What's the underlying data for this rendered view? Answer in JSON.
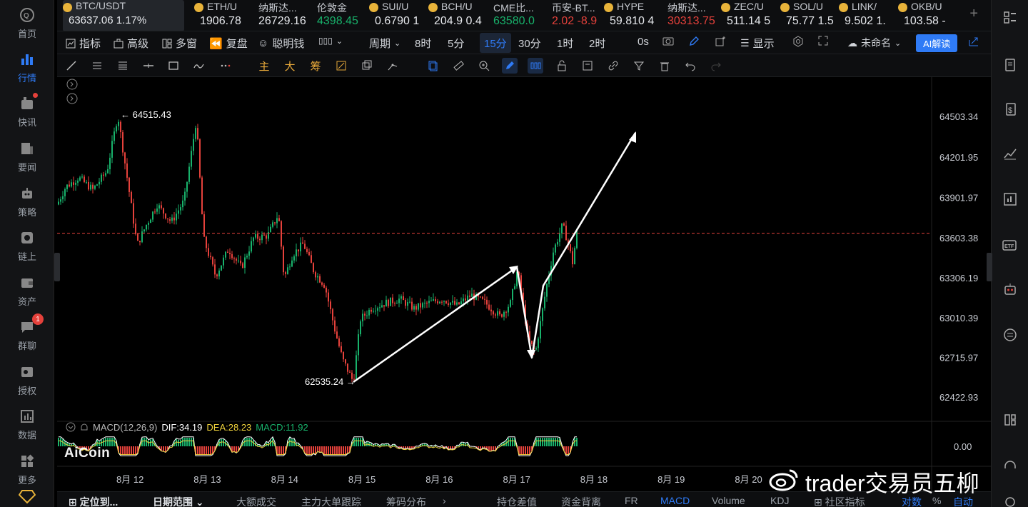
{
  "sidebar": {
    "items": [
      {
        "label": "首页",
        "icon": "home-icon"
      },
      {
        "label": "行情",
        "icon": "market-chart-icon",
        "active": true
      },
      {
        "label": "快讯",
        "icon": "flash-news-icon",
        "dot": true
      },
      {
        "label": "要闻",
        "icon": "news-icon"
      },
      {
        "label": "策略",
        "icon": "robot-strategy-icon"
      },
      {
        "label": "链上",
        "icon": "chain-icon"
      },
      {
        "label": "资产",
        "icon": "wallet-icon"
      },
      {
        "label": "群聊",
        "icon": "chat-icon",
        "badge": "1"
      },
      {
        "label": "授权",
        "icon": "key-icon"
      },
      {
        "label": "数据",
        "icon": "data-icon"
      },
      {
        "label": "更多",
        "icon": "more-grid-icon"
      }
    ]
  },
  "tickers": [
    {
      "name": "BTC/USDT",
      "price": "63637.06  1.17%",
      "color": "white",
      "icon": true
    },
    {
      "name": "ETH/U",
      "price": "1906.78",
      "color": "white",
      "icon": true
    },
    {
      "name": "纳斯达...",
      "price": "26729.16",
      "color": "white",
      "icon": false
    },
    {
      "name": "伦敦金",
      "price": "4398.45",
      "color": "green",
      "icon": false
    },
    {
      "name": "SUI/U",
      "price": "0.6790  1",
      "color": "white",
      "icon": true
    },
    {
      "name": "BCH/U",
      "price": "204.9  0.4",
      "color": "white",
      "icon": true
    },
    {
      "name": "CME比...",
      "price": "63580.0",
      "color": "green",
      "icon": false
    },
    {
      "name": "币安-BT...",
      "price": "2.02  -8.9",
      "color": "red",
      "icon": false
    },
    {
      "name": "HYPE",
      "price": "59.810  4",
      "color": "white",
      "icon": true
    },
    {
      "name": "纳斯达...",
      "price": "30313.75",
      "color": "red",
      "icon": false
    },
    {
      "name": "ZEC/U",
      "price": "511.14  5",
      "color": "white",
      "icon": true
    },
    {
      "name": "SOL/U",
      "price": "75.77  1.5",
      "color": "white",
      "icon": true
    },
    {
      "name": "LINK/",
      "price": "9.502  1.",
      "color": "white",
      "icon": true
    },
    {
      "name": "OKB/U",
      "price": "103.58  -",
      "color": "white",
      "icon": true
    }
  ],
  "toolbar": {
    "indicators": "指标",
    "advanced": "高级",
    "multi_window": "多窗",
    "replay": "复盘",
    "smart_money": "聪明钱",
    "period": "周期",
    "intervals": [
      "8时",
      "5分",
      "15分",
      "30分",
      "1时",
      "2时"
    ],
    "active_interval": "15分",
    "countdown": "0s",
    "display": "显示",
    "layout_name": "未命名",
    "ai_button": "AI解读"
  },
  "drawing_tools": {
    "main_label": "主",
    "large_label": "大",
    "chip_label": "筹"
  },
  "chart": {
    "price_axis": [
      "64503.34",
      "64201.95",
      "63901.97",
      "63603.38",
      "63306.19",
      "63010.39",
      "62715.97",
      "62422.93"
    ],
    "date_axis": [
      "8月 12",
      "8月 13",
      "8月 14",
      "8月 15",
      "8月 16",
      "8月 17",
      "8月 18",
      "8月 19",
      "8月 20"
    ],
    "high_label": "64515.43",
    "low_label": "62535.24",
    "current_price_line": 63637.06,
    "macd_zero": "0.00",
    "colors": {
      "up": "#18b26b",
      "down": "#e5413b",
      "dif": "#ffffff",
      "dea": "#f0d33c"
    }
  },
  "macd": {
    "name": "MACD(12,26,9)",
    "dif": "DIF:34.19",
    "dea": "DEA:28.23",
    "macd": "MACD:11.92"
  },
  "logo_text": "AiCoin",
  "watermark": "trader交易员五柳",
  "bottom_tabs": {
    "locate": "定位到...",
    "date_range": "日期范围",
    "large_volume": "大额成交",
    "main_orders": "主力大单跟踪",
    "chip_dist": "筹码分布",
    "position_diff": "持仓差值",
    "fund_divergence": "资金背离",
    "fr": "FR",
    "macd": "MACD",
    "volume": "Volume",
    "kdj": "KDJ",
    "community": "社区指标",
    "log": "对数",
    "percent": "%",
    "auto": "自动"
  }
}
